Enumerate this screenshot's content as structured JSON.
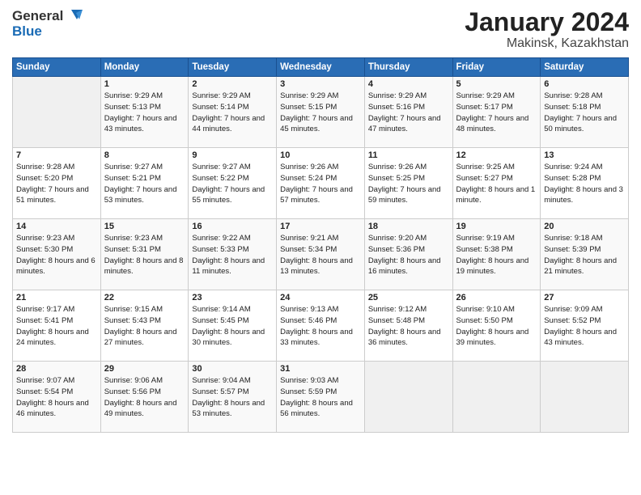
{
  "logo": {
    "general": "General",
    "blue": "Blue"
  },
  "header": {
    "month": "January 2024",
    "location": "Makinsk, Kazakhstan"
  },
  "weekdays": [
    "Sunday",
    "Monday",
    "Tuesday",
    "Wednesday",
    "Thursday",
    "Friday",
    "Saturday"
  ],
  "weeks": [
    [
      {
        "date": "",
        "sunrise": "",
        "sunset": "",
        "daylight": ""
      },
      {
        "date": "1",
        "sunrise": "Sunrise: 9:29 AM",
        "sunset": "Sunset: 5:13 PM",
        "daylight": "Daylight: 7 hours and 43 minutes."
      },
      {
        "date": "2",
        "sunrise": "Sunrise: 9:29 AM",
        "sunset": "Sunset: 5:14 PM",
        "daylight": "Daylight: 7 hours and 44 minutes."
      },
      {
        "date": "3",
        "sunrise": "Sunrise: 9:29 AM",
        "sunset": "Sunset: 5:15 PM",
        "daylight": "Daylight: 7 hours and 45 minutes."
      },
      {
        "date": "4",
        "sunrise": "Sunrise: 9:29 AM",
        "sunset": "Sunset: 5:16 PM",
        "daylight": "Daylight: 7 hours and 47 minutes."
      },
      {
        "date": "5",
        "sunrise": "Sunrise: 9:29 AM",
        "sunset": "Sunset: 5:17 PM",
        "daylight": "Daylight: 7 hours and 48 minutes."
      },
      {
        "date": "6",
        "sunrise": "Sunrise: 9:28 AM",
        "sunset": "Sunset: 5:18 PM",
        "daylight": "Daylight: 7 hours and 50 minutes."
      }
    ],
    [
      {
        "date": "7",
        "sunrise": "Sunrise: 9:28 AM",
        "sunset": "Sunset: 5:20 PM",
        "daylight": "Daylight: 7 hours and 51 minutes."
      },
      {
        "date": "8",
        "sunrise": "Sunrise: 9:27 AM",
        "sunset": "Sunset: 5:21 PM",
        "daylight": "Daylight: 7 hours and 53 minutes."
      },
      {
        "date": "9",
        "sunrise": "Sunrise: 9:27 AM",
        "sunset": "Sunset: 5:22 PM",
        "daylight": "Daylight: 7 hours and 55 minutes."
      },
      {
        "date": "10",
        "sunrise": "Sunrise: 9:26 AM",
        "sunset": "Sunset: 5:24 PM",
        "daylight": "Daylight: 7 hours and 57 minutes."
      },
      {
        "date": "11",
        "sunrise": "Sunrise: 9:26 AM",
        "sunset": "Sunset: 5:25 PM",
        "daylight": "Daylight: 7 hours and 59 minutes."
      },
      {
        "date": "12",
        "sunrise": "Sunrise: 9:25 AM",
        "sunset": "Sunset: 5:27 PM",
        "daylight": "Daylight: 8 hours and 1 minute."
      },
      {
        "date": "13",
        "sunrise": "Sunrise: 9:24 AM",
        "sunset": "Sunset: 5:28 PM",
        "daylight": "Daylight: 8 hours and 3 minutes."
      }
    ],
    [
      {
        "date": "14",
        "sunrise": "Sunrise: 9:23 AM",
        "sunset": "Sunset: 5:30 PM",
        "daylight": "Daylight: 8 hours and 6 minutes."
      },
      {
        "date": "15",
        "sunrise": "Sunrise: 9:23 AM",
        "sunset": "Sunset: 5:31 PM",
        "daylight": "Daylight: 8 hours and 8 minutes."
      },
      {
        "date": "16",
        "sunrise": "Sunrise: 9:22 AM",
        "sunset": "Sunset: 5:33 PM",
        "daylight": "Daylight: 8 hours and 11 minutes."
      },
      {
        "date": "17",
        "sunrise": "Sunrise: 9:21 AM",
        "sunset": "Sunset: 5:34 PM",
        "daylight": "Daylight: 8 hours and 13 minutes."
      },
      {
        "date": "18",
        "sunrise": "Sunrise: 9:20 AM",
        "sunset": "Sunset: 5:36 PM",
        "daylight": "Daylight: 8 hours and 16 minutes."
      },
      {
        "date": "19",
        "sunrise": "Sunrise: 9:19 AM",
        "sunset": "Sunset: 5:38 PM",
        "daylight": "Daylight: 8 hours and 19 minutes."
      },
      {
        "date": "20",
        "sunrise": "Sunrise: 9:18 AM",
        "sunset": "Sunset: 5:39 PM",
        "daylight": "Daylight: 8 hours and 21 minutes."
      }
    ],
    [
      {
        "date": "21",
        "sunrise": "Sunrise: 9:17 AM",
        "sunset": "Sunset: 5:41 PM",
        "daylight": "Daylight: 8 hours and 24 minutes."
      },
      {
        "date": "22",
        "sunrise": "Sunrise: 9:15 AM",
        "sunset": "Sunset: 5:43 PM",
        "daylight": "Daylight: 8 hours and 27 minutes."
      },
      {
        "date": "23",
        "sunrise": "Sunrise: 9:14 AM",
        "sunset": "Sunset: 5:45 PM",
        "daylight": "Daylight: 8 hours and 30 minutes."
      },
      {
        "date": "24",
        "sunrise": "Sunrise: 9:13 AM",
        "sunset": "Sunset: 5:46 PM",
        "daylight": "Daylight: 8 hours and 33 minutes."
      },
      {
        "date": "25",
        "sunrise": "Sunrise: 9:12 AM",
        "sunset": "Sunset: 5:48 PM",
        "daylight": "Daylight: 8 hours and 36 minutes."
      },
      {
        "date": "26",
        "sunrise": "Sunrise: 9:10 AM",
        "sunset": "Sunset: 5:50 PM",
        "daylight": "Daylight: 8 hours and 39 minutes."
      },
      {
        "date": "27",
        "sunrise": "Sunrise: 9:09 AM",
        "sunset": "Sunset: 5:52 PM",
        "daylight": "Daylight: 8 hours and 43 minutes."
      }
    ],
    [
      {
        "date": "28",
        "sunrise": "Sunrise: 9:07 AM",
        "sunset": "Sunset: 5:54 PM",
        "daylight": "Daylight: 8 hours and 46 minutes."
      },
      {
        "date": "29",
        "sunrise": "Sunrise: 9:06 AM",
        "sunset": "Sunset: 5:56 PM",
        "daylight": "Daylight: 8 hours and 49 minutes."
      },
      {
        "date": "30",
        "sunrise": "Sunrise: 9:04 AM",
        "sunset": "Sunset: 5:57 PM",
        "daylight": "Daylight: 8 hours and 53 minutes."
      },
      {
        "date": "31",
        "sunrise": "Sunrise: 9:03 AM",
        "sunset": "Sunset: 5:59 PM",
        "daylight": "Daylight: 8 hours and 56 minutes."
      },
      {
        "date": "",
        "sunrise": "",
        "sunset": "",
        "daylight": ""
      },
      {
        "date": "",
        "sunrise": "",
        "sunset": "",
        "daylight": ""
      },
      {
        "date": "",
        "sunrise": "",
        "sunset": "",
        "daylight": ""
      }
    ]
  ]
}
